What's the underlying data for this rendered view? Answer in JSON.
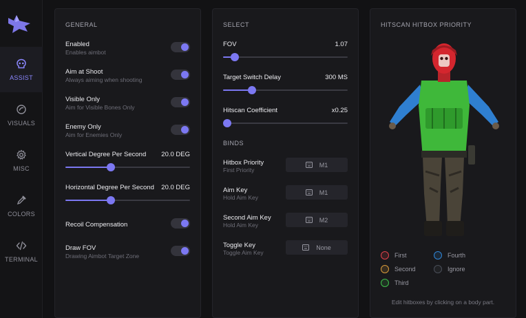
{
  "sidebar": {
    "items": [
      {
        "label": "ASSIST",
        "icon": "skull-icon",
        "active": true
      },
      {
        "label": "VISUALS",
        "icon": "eye-icon",
        "active": false
      },
      {
        "label": "MISC",
        "icon": "gear-icon",
        "active": false
      },
      {
        "label": "COLORS",
        "icon": "eyedropper-icon",
        "active": false
      },
      {
        "label": "TERMINAL",
        "icon": "code-icon",
        "active": false
      }
    ]
  },
  "general": {
    "title": "GENERAL",
    "enabled": {
      "title": "Enabled",
      "desc": "Enables aimbot",
      "on": true
    },
    "aim_at_shoot": {
      "title": "Aim at Shoot",
      "desc": "Always aiming when shooting",
      "on": true
    },
    "visible_only": {
      "title": "Visible Only",
      "desc": "Aim for Visible Bones Only",
      "on": true
    },
    "enemy_only": {
      "title": "Enemy Only",
      "desc": "Aim for Enemies Only",
      "on": true
    },
    "vertical": {
      "title": "Vertical Degree Per Second",
      "value": "20.0 DEG",
      "fraction": 0.33
    },
    "horizontal": {
      "title": "Horizontal Degree Per Second",
      "value": "20.0 DEG",
      "fraction": 0.33
    },
    "recoil": {
      "title": "Recoil Compensation",
      "on": true
    },
    "draw_fov": {
      "title": "Draw FOV",
      "desc": "Drawing Aimbot Target Zone",
      "on": true
    }
  },
  "select": {
    "title": "SELECT",
    "fov": {
      "title": "FOV",
      "value": "1.07",
      "fraction": 0.06
    },
    "switch_delay": {
      "title": "Target Switch Delay",
      "value": "300 MS",
      "fraction": 0.2
    },
    "hitscan_coef": {
      "title": "Hitscan Coefficient",
      "value": "x0.25",
      "fraction": 0.0
    }
  },
  "binds": {
    "title": "BINDS",
    "hitbox_priority": {
      "title": "Hitbox Priority",
      "desc": "First Priority",
      "key": "M1"
    },
    "aim_key": {
      "title": "Aim Key",
      "desc": "Hold Aim Key",
      "key": "M1"
    },
    "second_aim_key": {
      "title": "Second Aim Key",
      "desc": "Hold Aim Key",
      "key": "M2"
    },
    "toggle_key": {
      "title": "Toggle Key",
      "desc": "Toggle Aim Key",
      "key": "None"
    }
  },
  "hitbox": {
    "title": "HITSCAN HITBOX PRIORITY",
    "legend": [
      {
        "label": "First",
        "color": "#e0414a"
      },
      {
        "label": "Second",
        "color": "#d99a3a"
      },
      {
        "label": "Third",
        "color": "#3fbf4a"
      },
      {
        "label": "Fourth",
        "color": "#2f86d8"
      },
      {
        "label": "Ignore",
        "color": "#4a4e58"
      }
    ],
    "hint": "Edit hitboxes by clicking on a body part."
  },
  "colors": {
    "accent": "#7c78f2",
    "head": "#d4262e",
    "torso": "#3fb83a",
    "arms": "#2f7fd0"
  }
}
